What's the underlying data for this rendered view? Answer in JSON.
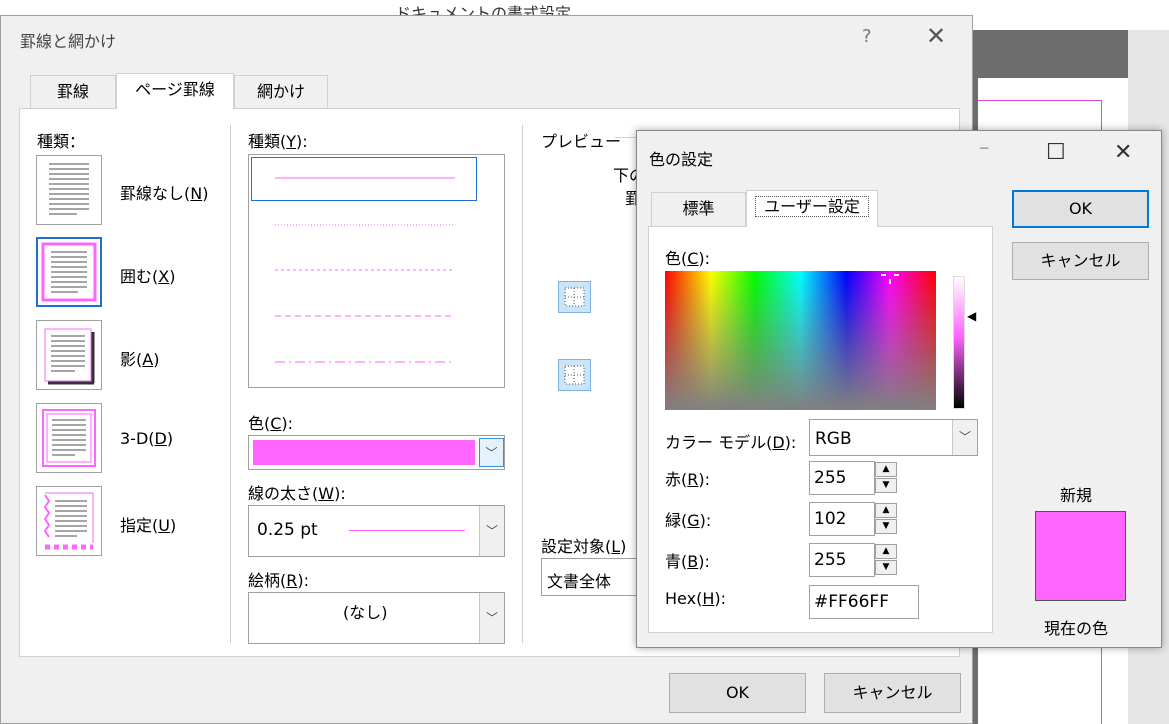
{
  "background": {
    "window_title_fragment": "ドキュメントの書式設定"
  },
  "main_dialog": {
    "title": "罫線と網かけ",
    "help": "?",
    "close": "✕",
    "tabs": [
      {
        "label": "罫線"
      },
      {
        "label": "ページ罫線"
      },
      {
        "label": "網かけ"
      }
    ],
    "kind_label": "種類：",
    "settings": [
      {
        "label": "罫線なし(",
        "key": "N",
        "suffix": ")"
      },
      {
        "label": "囲む(",
        "key": "X",
        "suffix": ")"
      },
      {
        "label": "影(",
        "key": "A",
        "suffix": ")"
      },
      {
        "label": "3-D(",
        "key": "D",
        "suffix": ")"
      },
      {
        "label": "指定(",
        "key": "U",
        "suffix": ")"
      }
    ],
    "style_label": {
      "text": "種類(",
      "key": "Y",
      "suffix": "):"
    },
    "color_label": {
      "text": "色(",
      "key": "C",
      "suffix": "):"
    },
    "color_value": "#FF66FF",
    "width_label": {
      "text": "線の太さ(",
      "key": "W",
      "suffix": "):"
    },
    "width_value": "0.25 pt",
    "art_label": {
      "text": "絵柄(",
      "key": "R",
      "suffix": "):"
    },
    "art_value": "(なし)",
    "preview_label": "プレビュー",
    "preview_hint_1": "下の",
    "preview_hint_2": "罫",
    "apply_label": {
      "text": "設定対象(",
      "key": "L",
      "suffix": ")"
    },
    "apply_value": "文書全体",
    "ok": "OK",
    "cancel": "キャンセル"
  },
  "color_dialog": {
    "title": "色の設定",
    "minimize": "─",
    "maximize": "☐",
    "close": "✕",
    "tabs": [
      {
        "label": "標準"
      },
      {
        "label": "ユーザー設定"
      }
    ],
    "colors_label": {
      "text": "色(",
      "key": "C",
      "suffix": "):"
    },
    "model_label": {
      "text": "カラー モデル(",
      "key": "D",
      "suffix": "):"
    },
    "model_value": "RGB",
    "red_label": {
      "text": "赤(",
      "key": "R",
      "suffix": "):"
    },
    "red_value": "255",
    "green_label": {
      "text": "緑(",
      "key": "G",
      "suffix": "):"
    },
    "green_value": "102",
    "blue_label": {
      "text": "青(",
      "key": "B",
      "suffix": "):"
    },
    "blue_value": "255",
    "hex_label": {
      "text": "Hex(",
      "key": "H",
      "suffix": "):"
    },
    "hex_value": "#FF66FF",
    "ok": "OK",
    "cancel": "キャンセル",
    "new_label": "新規",
    "current_label": "現在の色",
    "swatch_color": "#FF66FF"
  },
  "colors": {
    "accent": "#0078D7",
    "line": "#FF66FF"
  }
}
